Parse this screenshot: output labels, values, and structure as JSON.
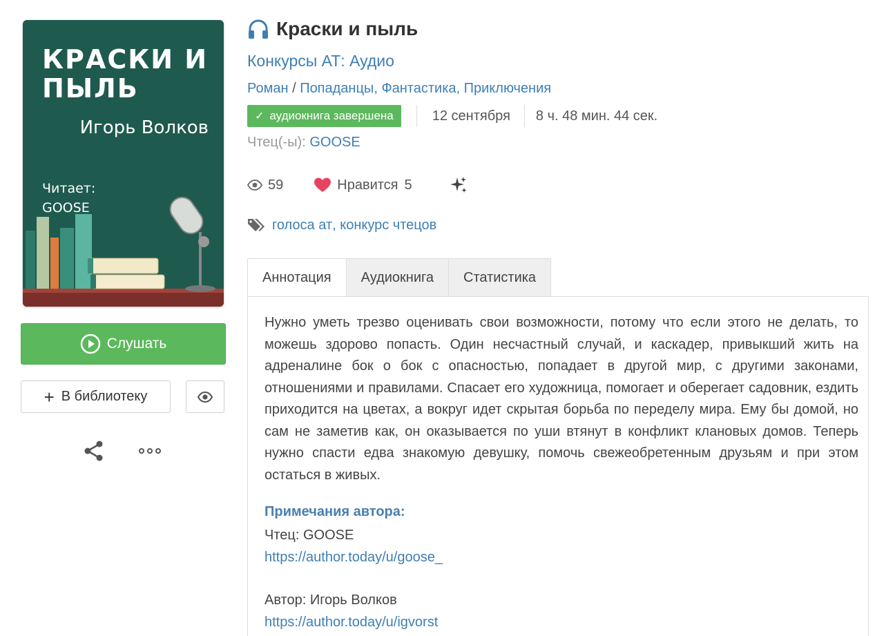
{
  "cover": {
    "title": "КРАСКИ И ПЫЛЬ",
    "author": "Игорь Волков",
    "reader_label": "Читает:",
    "reader_name": "GOOSE",
    "bg_color": "#1f5a4e"
  },
  "actions": {
    "listen_label": "Слушать",
    "library_label": "В библиотеку"
  },
  "book": {
    "title": "Краски и пыль",
    "series": "Конкурсы АТ: Аудио",
    "genre_form": "Роман",
    "genres": [
      "Попаданцы",
      "Фантастика",
      "Приключения"
    ],
    "status": "аудиокнига завершена",
    "date": "12 сентября",
    "duration": "8 ч. 48 мин. 44 сек.",
    "reader_label": "Чтец(-ы):",
    "reader_name": "GOOSE"
  },
  "stats": {
    "views": "59",
    "likes_label": "Нравится",
    "likes": "5"
  },
  "tags": [
    "голоса ат",
    "конкурс чтецов"
  ],
  "tabs": [
    {
      "label": "Аннотация",
      "active": true
    },
    {
      "label": "Аудиокнига",
      "active": false
    },
    {
      "label": "Статистика",
      "active": false
    }
  ],
  "annotation": {
    "text": "Нужно уметь трезво оценивать свои возможности, потому что если этого не делать, то можешь здорово попасть. Один несчастный случай, и каскадер, привыкший жить на адреналине бок о бок с опасностью, попадает в другой мир, с другими законами, отношениями и правилами. Спасает его художница, помогает и оберегает садовник, ездить приходится на цветах, а вокруг идет скрытая борьба по переделу мира. Ему бы домой, но сам не заметив как, он оказывается по уши втянут в конфликт клановых домов. Теперь нужно спасти едва знакомую девушку, помочь свежеобретенным друзьям и при этом остаться в живых.",
    "notes_title": "Примечания автора:",
    "reader_line": "Чтец: GOOSE",
    "reader_link": "https://author.today/u/goose_",
    "author_line": "Автор: Игорь Волков",
    "author_link": "https://author.today/u/igvorst"
  },
  "colors": {
    "link": "#3d7fb5",
    "success": "#5cb85c",
    "heart": "#e8435e"
  },
  "icons": [
    "headphones-icon",
    "play-circle-icon",
    "plus-icon",
    "eye-icon",
    "share-icon",
    "more-icon",
    "heart-icon",
    "sparkle-icon",
    "tags-icon",
    "check-icon"
  ]
}
